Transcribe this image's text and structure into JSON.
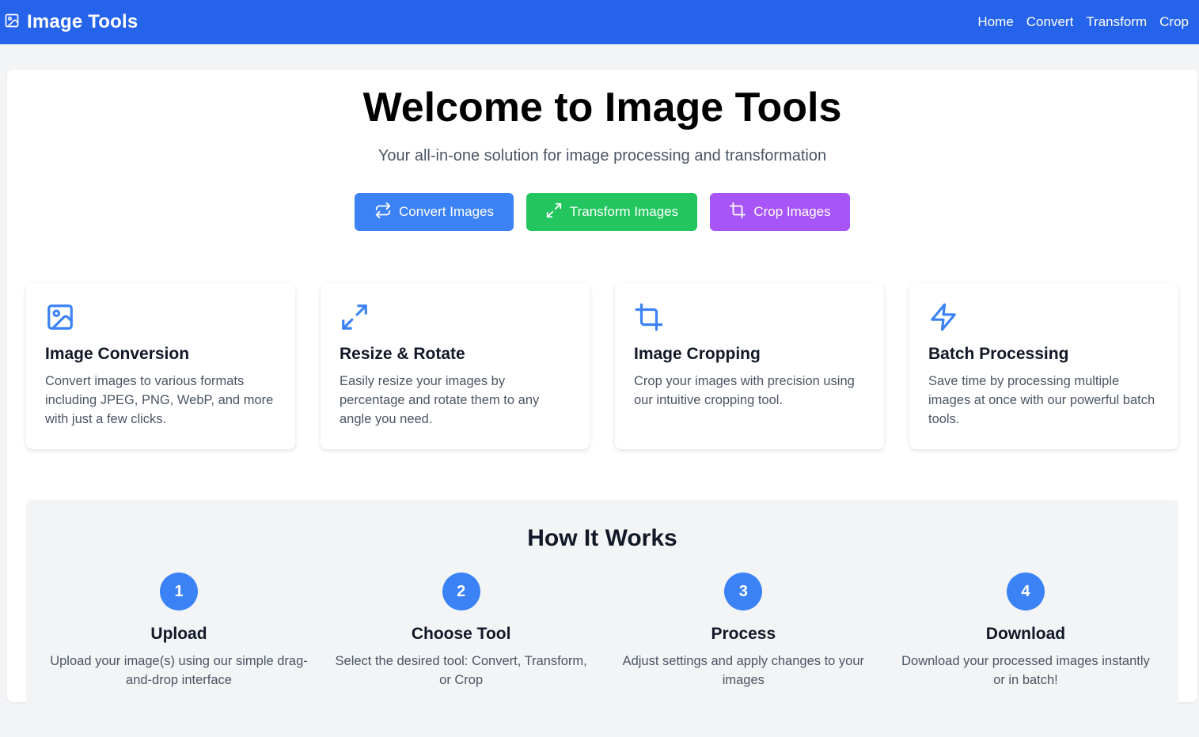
{
  "navbar": {
    "brand_icon": "image-icon",
    "brand": "Image Tools",
    "links": [
      "Home",
      "Convert",
      "Transform",
      "Crop"
    ],
    "color": "#2563eb"
  },
  "hero": {
    "title": "Welcome to Image Tools",
    "subtitle": "Your all-in-one solution for image processing and transformation",
    "buttons": [
      {
        "label": "Convert Images",
        "icon": "convert-arrows-icon",
        "color": "#3b82f6"
      },
      {
        "label": "Transform Images",
        "icon": "expand-arrows-icon",
        "color": "#22c55e"
      },
      {
        "label": "Crop Images",
        "icon": "crop-icon",
        "color": "#a855f7"
      }
    ]
  },
  "features": [
    {
      "icon": "image-icon",
      "title": "Image Conversion",
      "desc": "Convert images to various formats including JPEG, PNG, WebP, and more with just a few clicks."
    },
    {
      "icon": "expand-arrows-icon",
      "title": "Resize & Rotate",
      "desc": "Easily resize your images by percentage and rotate them to any angle you need."
    },
    {
      "icon": "crop-icon",
      "title": "Image Cropping",
      "desc": "Crop your images with precision using our intuitive cropping tool."
    },
    {
      "icon": "lightning-icon",
      "title": "Batch Processing",
      "desc": "Save time by processing multiple images at once with our powerful batch tools."
    }
  ],
  "how": {
    "title": "How It Works",
    "steps": [
      {
        "num": "1",
        "title": "Upload",
        "desc": "Upload your image(s) using our simple drag-and-drop interface"
      },
      {
        "num": "2",
        "title": "Choose Tool",
        "desc": "Select the desired tool: Convert, Transform, or Crop"
      },
      {
        "num": "3",
        "title": "Process",
        "desc": "Adjust settings and apply changes to your images"
      },
      {
        "num": "4",
        "title": "Download",
        "desc": "Download your processed images instantly or in batch!"
      }
    ]
  },
  "accent_color": "#3b82f6"
}
